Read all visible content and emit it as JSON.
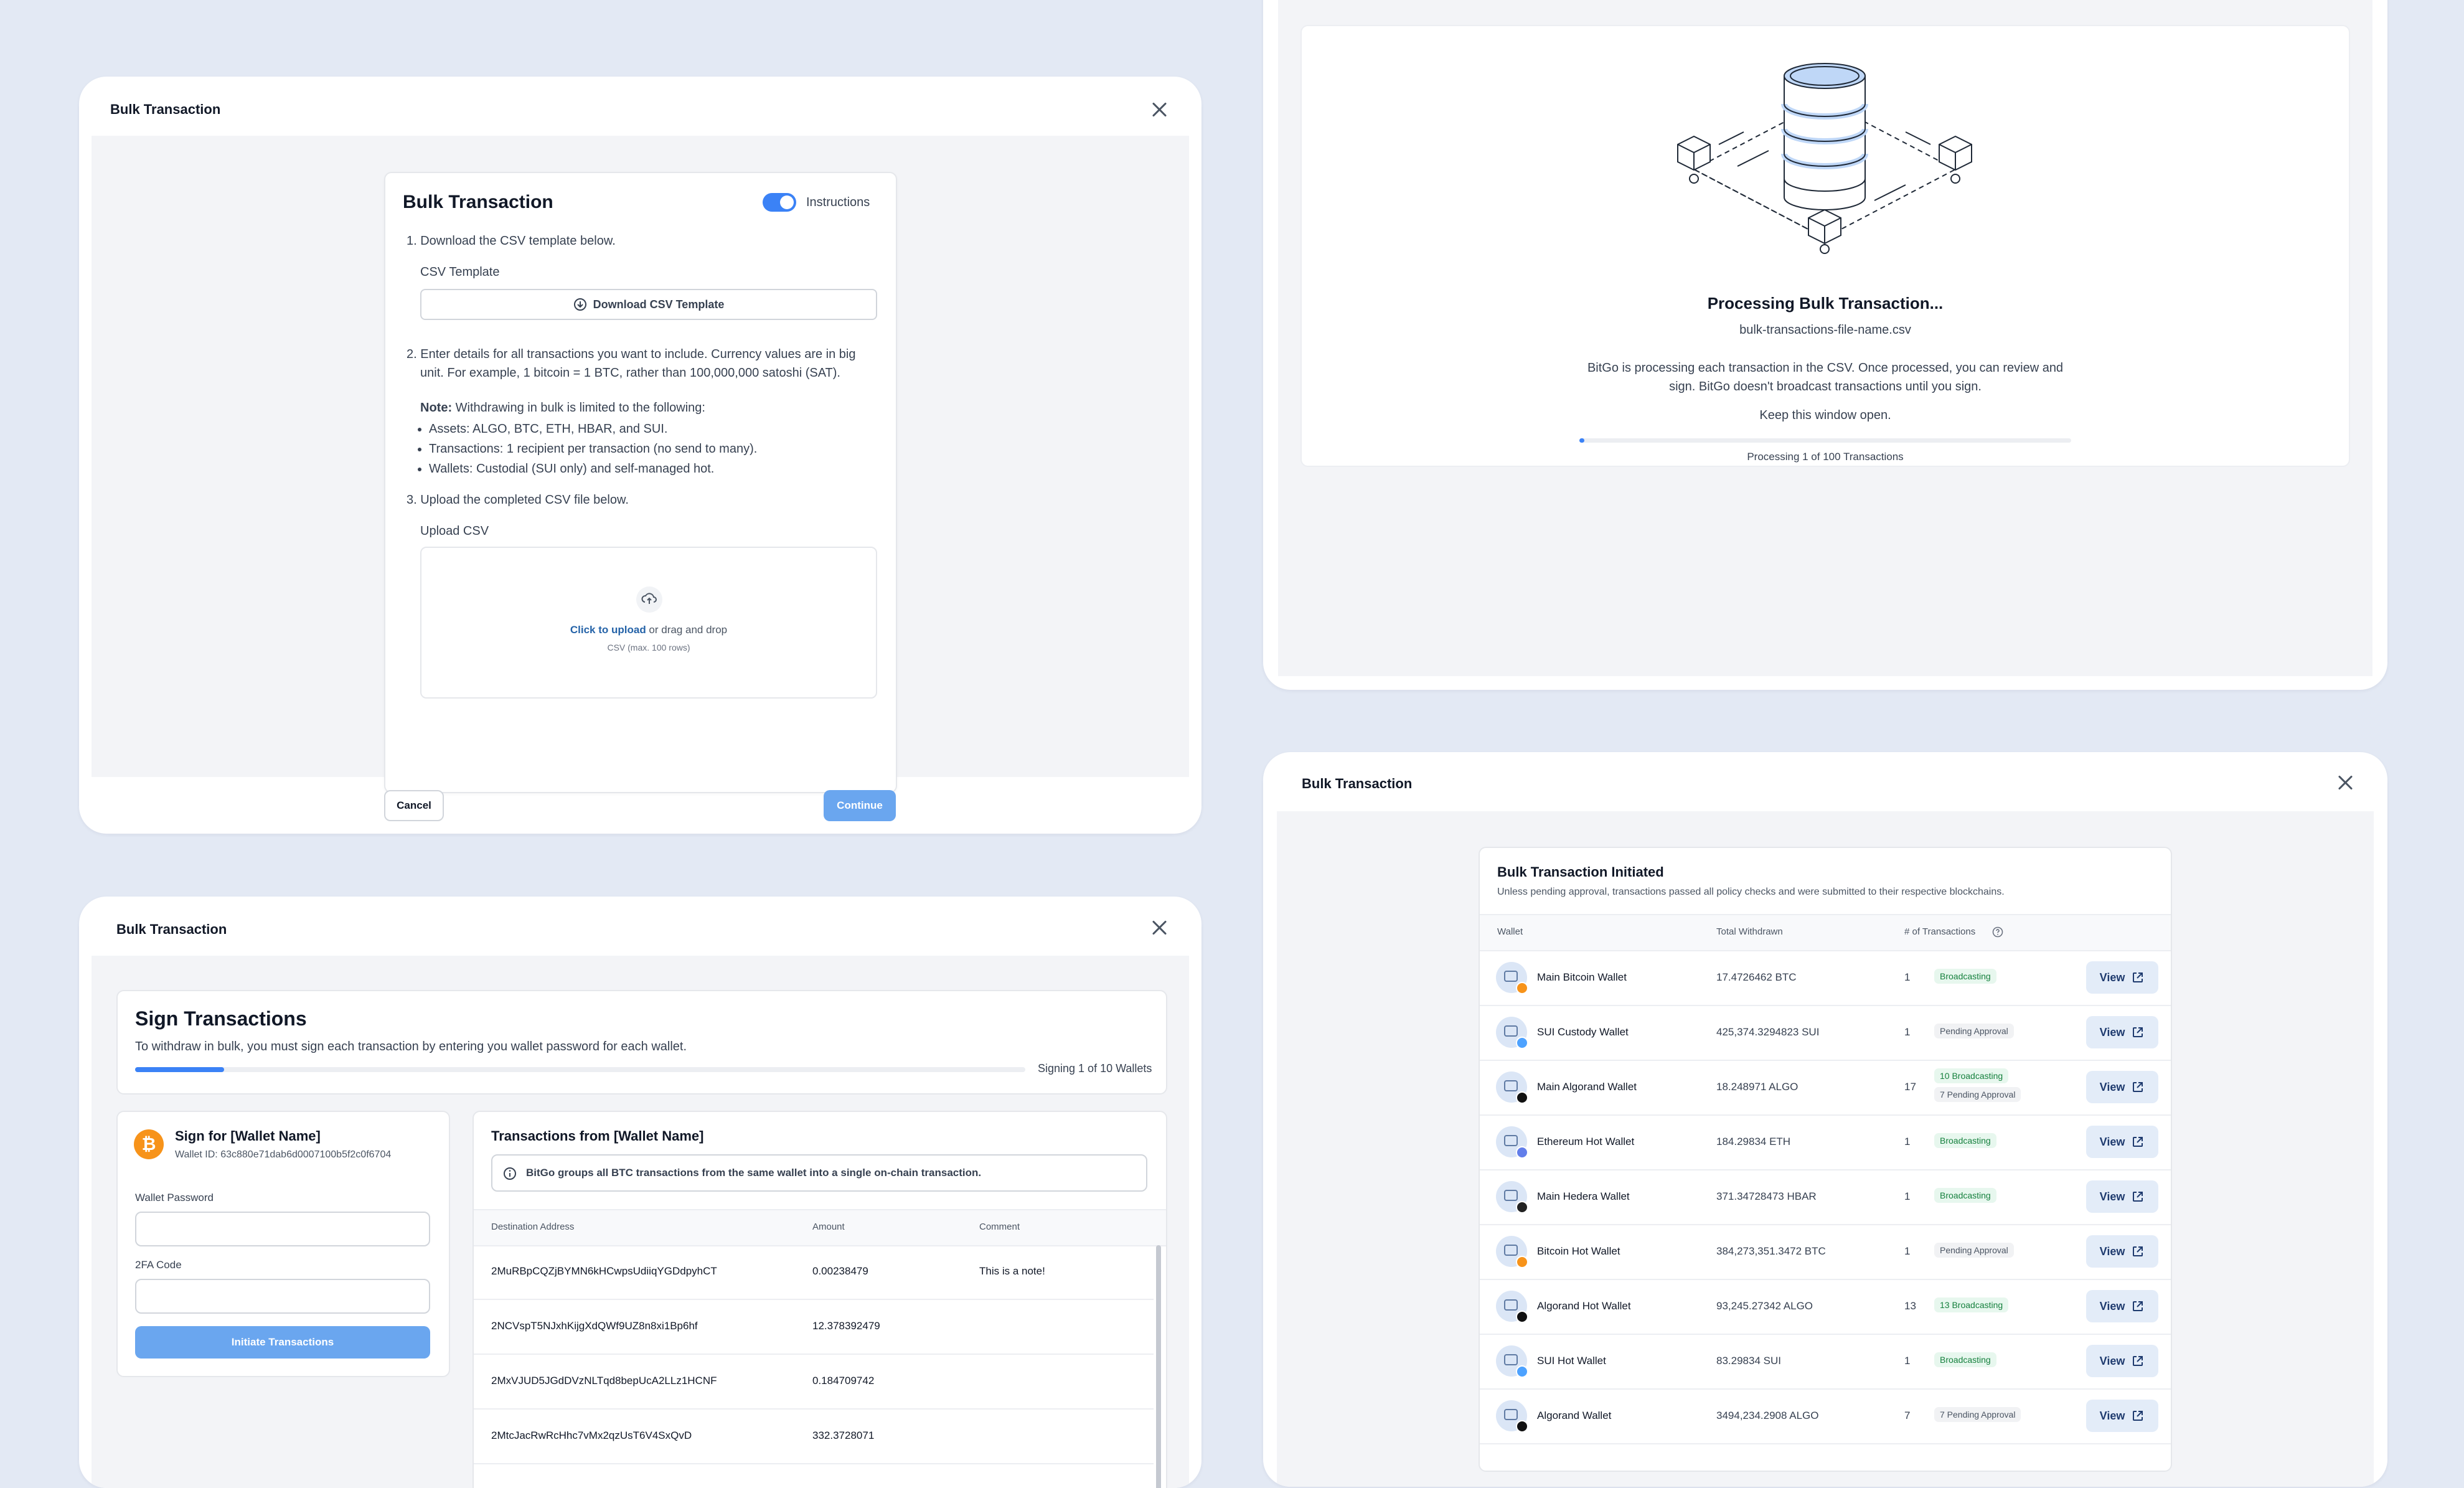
{
  "colors": {
    "background": "#e3e9f4",
    "accent": "#3b82f6",
    "accent_light": "#6aa6ef",
    "bitcoin": "#f7931a",
    "success": "#15803d"
  },
  "card1": {
    "title": "Bulk Transaction",
    "inner_title": "Bulk Transaction",
    "toggle_label": "Instructions",
    "step1": "1. Download the CSV template below.",
    "csv_template_label": "CSV Template",
    "download_button": "Download CSV Template",
    "step2": "2. Enter details for all transactions you want to include. Currency values are in big unit. For example, 1 bitcoin = 1 BTC, rather than 100,000,000 satoshi (SAT).",
    "note_label": "Note:",
    "note_text": " Withdrawing in bulk is limited to the following:",
    "bullets": [
      "Assets: ALGO, BTC, ETH, HBAR, and SUI.",
      "Transactions: 1 recipient per transaction (no send to many).",
      "Wallets: Custodial (SUI only) and self-managed hot."
    ],
    "step3": "3. Upload the completed CSV file below.",
    "upload_label": "Upload CSV",
    "click_upload": "Click to upload",
    "drag_drop": " or drag and drop",
    "upload_hint": "CSV (max. 100 rows)",
    "cancel": "Cancel",
    "continue": "Continue"
  },
  "card2": {
    "processing_title": "Processing Bulk Transaction...",
    "file_name": "bulk-transactions-file-name.csv",
    "description": "BitGo is processing each transaction in the CSV. Once processed, you can review and sign. BitGo doesn't broadcast transactions until you sign.",
    "keep_open": "Keep this window open.",
    "progress_text": "Processing 1 of 100 Transactions",
    "progress_fraction": 0.01
  },
  "card3": {
    "title": "Bulk Transaction",
    "sign_title": "Sign Transactions",
    "sign_desc": "To withdraw in bulk, you must sign each transaction by entering you wallet password for each wallet.",
    "signing_progress": "Signing 1 of 10 Wallets",
    "progress_fraction": 0.1,
    "sign_for": "Sign for [Wallet Name]",
    "wallet_id": "Wallet ID: 63c880e71dab6d0007100b5f2c0f6704",
    "password_label": "Wallet Password",
    "twofa_label": "2FA Code",
    "initiate_button": "Initiate Transactions",
    "tx_title": "Transactions from [Wallet Name]",
    "info_text": "BitGo groups all BTC transactions from the same wallet into a single on-chain transaction.",
    "columns": [
      "Destination Address",
      "Amount",
      "Comment"
    ],
    "rows": [
      {
        "address": "2MuRBpCQZjBYMN6kHCwpsUdiiqYGDdpyhCT",
        "amount": "0.00238479",
        "comment": "This is a note!"
      },
      {
        "address": "2NCVspT5NJxhKijgXdQWf9UZ8n8xi1Bp6hf",
        "amount": "12.378392479",
        "comment": ""
      },
      {
        "address": "2MxVJUD5JGdDVzNLTqd8bepUcA2LLz1HCNF",
        "amount": "0.184709742",
        "comment": ""
      },
      {
        "address": "2MtcJacRwRcHhc7vMx2qzUsT6V4SxQvD",
        "amount": "332.3728071",
        "comment": ""
      }
    ]
  },
  "card4": {
    "title": "Bulk Transaction",
    "initiated_title": "Bulk Transaction Initiated",
    "initiated_desc": "Unless pending approval, transactions passed all policy checks and were submitted to their respective blockchains.",
    "columns": [
      "Wallet",
      "Total Withdrawn",
      "# of Transactions"
    ],
    "view_label": "View",
    "rows": [
      {
        "wallet": "Main Bitcoin Wallet",
        "total": "17.4726462 BTC",
        "count": "1",
        "badges": [
          {
            "text": "Broadcasting",
            "kind": "green"
          }
        ],
        "coin_color": "#f7931a"
      },
      {
        "wallet": "SUI Custody Wallet",
        "total": "425,374.3294823 SUI",
        "count": "1",
        "badges": [
          {
            "text": "Pending Approval",
            "kind": "gray"
          }
        ],
        "coin_color": "#4da2ff"
      },
      {
        "wallet": "Main Algorand Wallet",
        "total": "18.248971 ALGO",
        "count": "17",
        "badges": [
          {
            "text": "10 Broadcasting",
            "kind": "green"
          },
          {
            "text": "7 Pending Approval",
            "kind": "gray"
          }
        ],
        "coin_color": "#111111"
      },
      {
        "wallet": "Ethereum Hot Wallet",
        "total": "184.29834 ETH",
        "count": "1",
        "badges": [
          {
            "text": "Broadcasting",
            "kind": "green"
          }
        ],
        "coin_color": "#627eea"
      },
      {
        "wallet": "Main Hedera Wallet",
        "total": "371.34728473 HBAR",
        "count": "1",
        "badges": [
          {
            "text": "Broadcasting",
            "kind": "green"
          }
        ],
        "coin_color": "#222222"
      },
      {
        "wallet": "Bitcoin Hot Wallet",
        "total": "384,273,351.3472 BTC",
        "count": "1",
        "badges": [
          {
            "text": "Pending Approval",
            "kind": "gray"
          }
        ],
        "coin_color": "#f7931a"
      },
      {
        "wallet": "Algorand Hot Wallet",
        "total": "93,245.27342 ALGO",
        "count": "13",
        "badges": [
          {
            "text": "13 Broadcasting",
            "kind": "green"
          }
        ],
        "coin_color": "#111111"
      },
      {
        "wallet": "SUI Hot Wallet",
        "total": "83.29834 SUI",
        "count": "1",
        "badges": [
          {
            "text": "Broadcasting",
            "kind": "green"
          }
        ],
        "coin_color": "#4da2ff"
      },
      {
        "wallet": "Algorand Wallet",
        "total": "3494,234.2908 ALGO",
        "count": "7",
        "badges": [
          {
            "text": "7 Pending Approval",
            "kind": "gray"
          }
        ],
        "coin_color": "#111111"
      }
    ]
  }
}
